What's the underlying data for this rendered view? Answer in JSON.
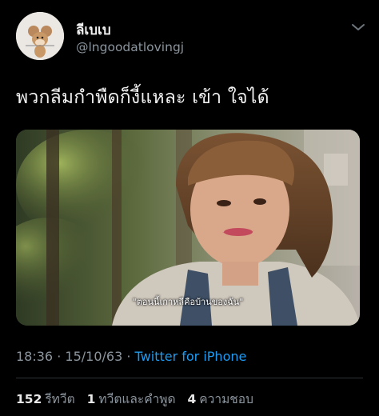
{
  "tweet": {
    "author": {
      "display_name": "ลีเบเบ",
      "handle": "@lngoodatlovingj",
      "avatar_icon": "jerry-mouse-avatar"
    },
    "text": "พวกลีมกำพืดก็งี้แหละ เข้า ใจได้",
    "media": {
      "subtitle": "\"ตอนนี้เกาหลีคือบ้านของฉัน\""
    },
    "time": "18:36",
    "separator": "·",
    "date": "15/10/63",
    "source": "Twitter for iPhone",
    "stats": {
      "retweets_count": "152",
      "retweets_label": "รีทวีต",
      "quotes_count": "1",
      "quotes_label": "ทวีตและคำพูด",
      "likes_count": "4",
      "likes_label": "ความชอบ"
    }
  },
  "colors": {
    "background": "#000000",
    "muted": "#8b959e",
    "link": "#1d9bf0",
    "divider": "#2f3336"
  }
}
